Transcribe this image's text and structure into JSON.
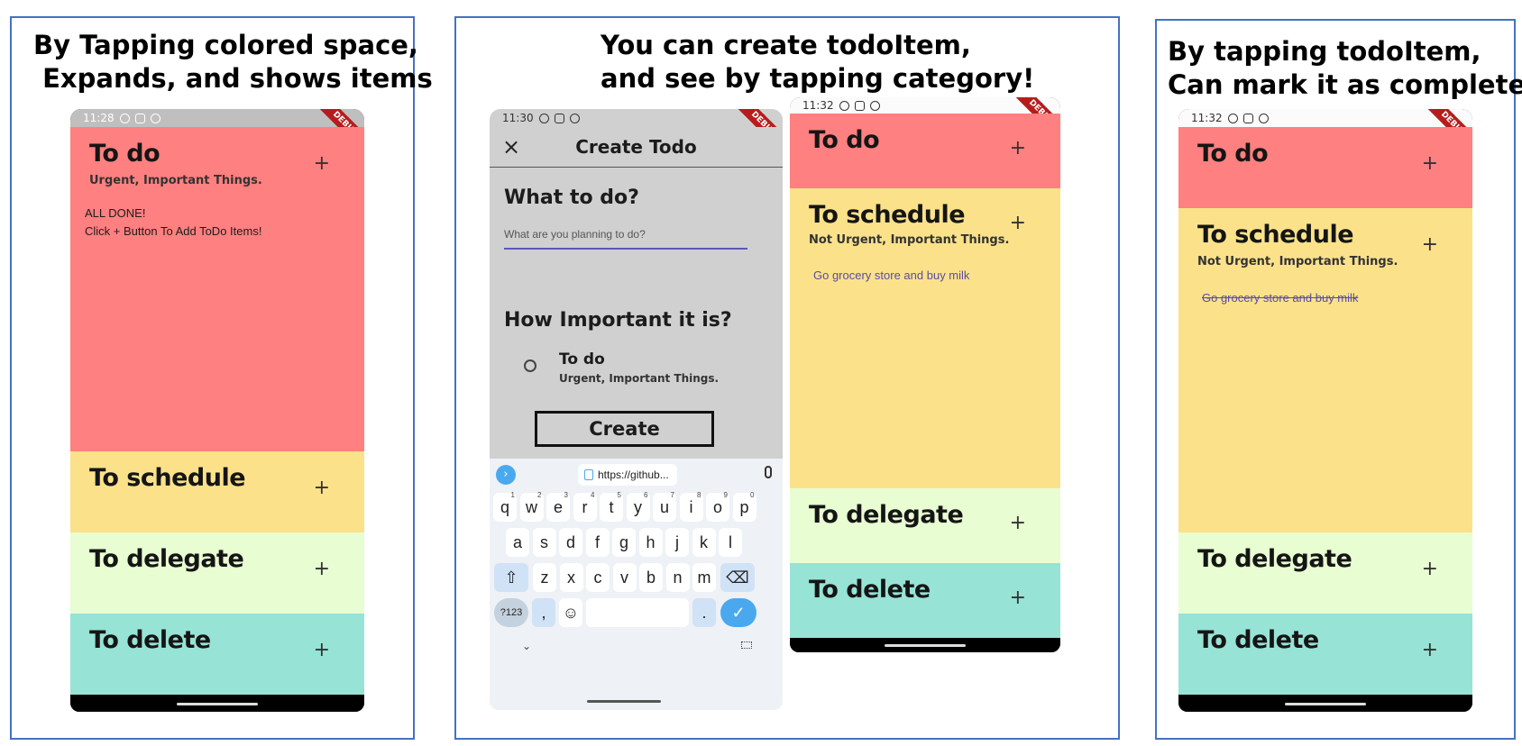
{
  "panels": [
    {
      "caption_lines": [
        "By Tapping colored space,",
        " Expands, and shows items"
      ]
    },
    {
      "caption_lines": [
        "You can create todoItem,",
        "and see by tapping category!"
      ]
    },
    {
      "caption_lines": [
        "By tapping todoItem,",
        "Can mark it as complete"
      ]
    }
  ],
  "phone1": {
    "time": "11:28",
    "debug": "DEBUG",
    "sections": [
      {
        "title": "To do",
        "subtitle": "Urgent, Important Things.",
        "plus": "+"
      },
      {
        "title": "To schedule",
        "plus": "+"
      },
      {
        "title": "To delegate",
        "plus": "+"
      },
      {
        "title": "To delete",
        "plus": "+"
      }
    ],
    "empty_line1": "ALL DONE!",
    "empty_line2": "Click + Button To Add ToDo Items!"
  },
  "phone2": {
    "time": "11:30",
    "debug": "DEBUG",
    "appbar_title": "Create Todo",
    "close_glyph": "×",
    "q1": "What to do?",
    "input_placeholder": "What are you planning to do?",
    "q2": "How Important it is?",
    "radio_title": "To do",
    "radio_sub": "Urgent, Important Things.",
    "create_label": "Create",
    "url_chip": "https://github...",
    "keyboard": {
      "row1": [
        "q",
        "w",
        "e",
        "r",
        "t",
        "y",
        "u",
        "i",
        "o",
        "p"
      ],
      "row1_sup": [
        "1",
        "2",
        "3",
        "4",
        "5",
        "6",
        "7",
        "8",
        "9",
        "0"
      ],
      "row2": [
        "a",
        "s",
        "d",
        "f",
        "g",
        "h",
        "j",
        "k",
        "l"
      ],
      "row3": [
        "z",
        "x",
        "c",
        "v",
        "b",
        "n",
        "m"
      ],
      "sym": "?123",
      "comma": ",",
      "period": "."
    }
  },
  "phone3": {
    "time": "11:32",
    "debug": "DEBUG",
    "sections": [
      {
        "title": "To do",
        "plus": "+"
      },
      {
        "title": "To schedule",
        "subtitle": "Not Urgent, Important Things.",
        "plus": "+"
      },
      {
        "title": "To delegate",
        "plus": "+"
      },
      {
        "title": "To delete",
        "plus": "+"
      }
    ],
    "item": "Go grocery store and buy milk"
  },
  "phone4": {
    "time": "11:32",
    "debug": "DEBUG",
    "sections": [
      {
        "title": "To do",
        "plus": "+"
      },
      {
        "title": "To schedule",
        "subtitle": "Not Urgent, Important Things.",
        "plus": "+"
      },
      {
        "title": "To delegate",
        "plus": "+"
      },
      {
        "title": "To delete",
        "plus": "+"
      }
    ],
    "item": "Go grocery store and buy milk"
  },
  "colors": {
    "todo": "#ff8080",
    "schedule": "#fbe28a",
    "delegate": "#e8fdd2",
    "delete": "#97e3d6",
    "panel_border": "#4472c4",
    "create_screen_bg": "#d0d0d0",
    "item_text": "#5b4aa6"
  }
}
